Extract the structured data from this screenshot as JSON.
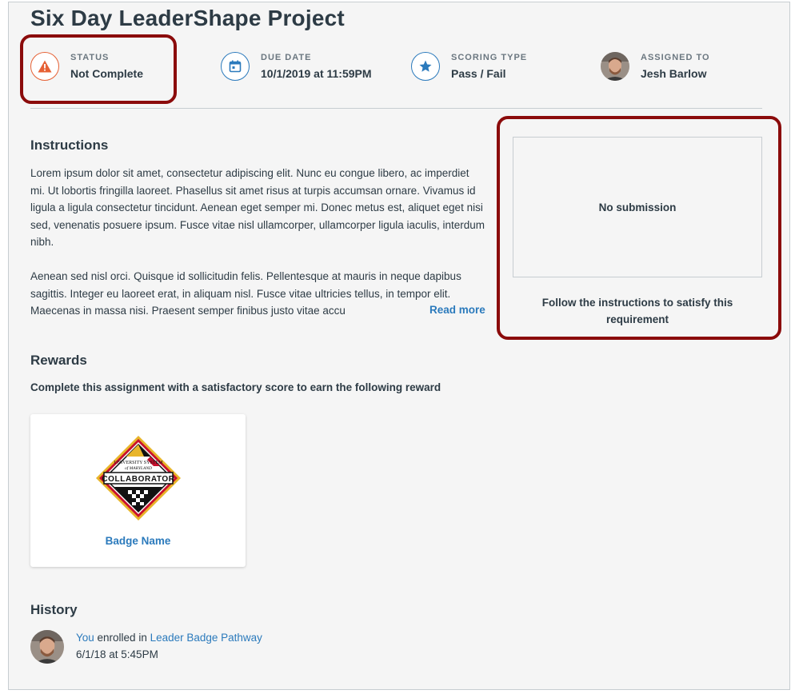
{
  "page": {
    "title": "Six Day LeaderShape Project"
  },
  "meta": {
    "status": {
      "label": "STATUS",
      "value": "Not Complete",
      "icon": "warning-icon",
      "color": "#e66135"
    },
    "due": {
      "label": "DUE DATE",
      "value": "10/1/2019 at 11:59PM",
      "icon": "calendar-icon"
    },
    "scoring": {
      "label": "SCORING TYPE",
      "value": "Pass / Fail",
      "icon": "star-icon"
    },
    "assigned": {
      "label": "ASSIGNED TO",
      "value": "Jesh Barlow"
    }
  },
  "instructions": {
    "heading": "Instructions",
    "paragraphs": [
      "Lorem ipsum dolor sit amet, consectetur adipiscing elit. Nunc eu congue libero, ac imperdiet mi. Ut lobortis fringilla laoreet. Phasellus sit amet risus at turpis accumsan ornare. Vivamus id ligula a ligula consectetur tincidunt. Aenean eget semper mi. Donec metus est, aliquet eget nisi sed, venenatis posuere ipsum. Fusce vitae nisl ullamcorper, ullamcorper ligula iaculis, interdum nibh.",
      "Aenean sed nisl orci. Quisque id sollicitudin felis. Pellentesque at mauris in neque dapibus sagittis. Integer eu laoreet erat, in aliquam nisl. Fusce vitae ultricies tellus, in tempor elit. Maecenas in massa nisi. Praesent semper finibus justo vitae accu"
    ],
    "read_more": "Read more"
  },
  "submission": {
    "status": "No submission",
    "hint": "Follow the instructions to satisfy this requirement"
  },
  "rewards": {
    "heading": "Rewards",
    "subtitle": "Complete this assignment with a satisfactory score to earn the following reward",
    "badge": {
      "name": "Badge Name",
      "art_top": "UNIVERSITY SYSTEM",
      "art_mid": "of MARYLAND",
      "art_banner": "COLLABORATOR"
    }
  },
  "history": {
    "heading": "History",
    "actor": "You",
    "verb": " enrolled in ",
    "target": "Leader Badge Pathway",
    "time": "6/1/18 at 5:45PM"
  },
  "colors": {
    "accent": "#2b7abc",
    "warning": "#e66135",
    "highlight": "#8b0b0b"
  }
}
